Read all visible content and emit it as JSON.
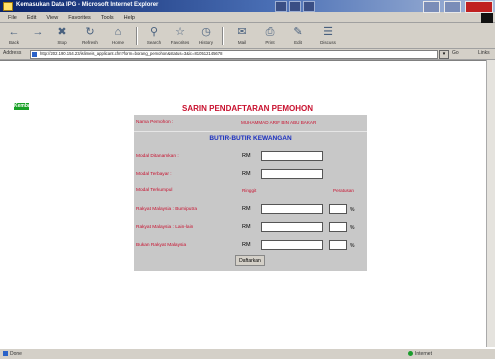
{
  "window": {
    "title": "Kemasukan Data IPG - Microsoft Internet Explorer"
  },
  "menu": [
    "File",
    "Edit",
    "View",
    "Favorites",
    "Tools",
    "Help"
  ],
  "toolbar": {
    "back": "Back",
    "forward": "",
    "stop": "Stop",
    "refresh": "Refresh",
    "home": "Home",
    "search": "Search",
    "favorites": "Favorites",
    "history": "History",
    "mail": "Mail",
    "print": "Print",
    "edit": "Edit",
    "discuss": "Discuss"
  },
  "address": {
    "label": "Address",
    "url": "http://202.190.154.23/islimeis_applicant.cfm?form=borang_pemohon&status=3&ic=810512145678",
    "go": "Go",
    "links": "Links"
  },
  "page": {
    "back_badge": "Kembali",
    "title": "SARIN PENDAFTARAN PEMOHON",
    "nama_label": "Nama Pemohon :",
    "nama_value": "MUHAMMAD ARIF BIN ABU BAKAR",
    "section": "BUTIR-BUTIR KEWANGAN",
    "rows": [
      {
        "label": "Modal Ditanamkan :",
        "rm": "RM"
      },
      {
        "label": "Modal Terbayar :",
        "rm": "RM"
      }
    ],
    "struct_label": "Modal Terkumpul",
    "struct_col1": "Ringgit",
    "struct_col2": "Peratusan",
    "eq_rows": [
      {
        "label": "Rakyat Malaysia : Bumiputra",
        "rm": "RM",
        "pct": "%"
      },
      {
        "label": "Rakyat Malaysia : Lain-lain",
        "rm": "RM",
        "pct": "%"
      },
      {
        "label": "Bukan Rakyat Malaysia",
        "rm": "RM",
        "pct": "%"
      }
    ],
    "submit": "Daftarkan"
  },
  "status": {
    "text": "Done",
    "zone": "Internet"
  }
}
